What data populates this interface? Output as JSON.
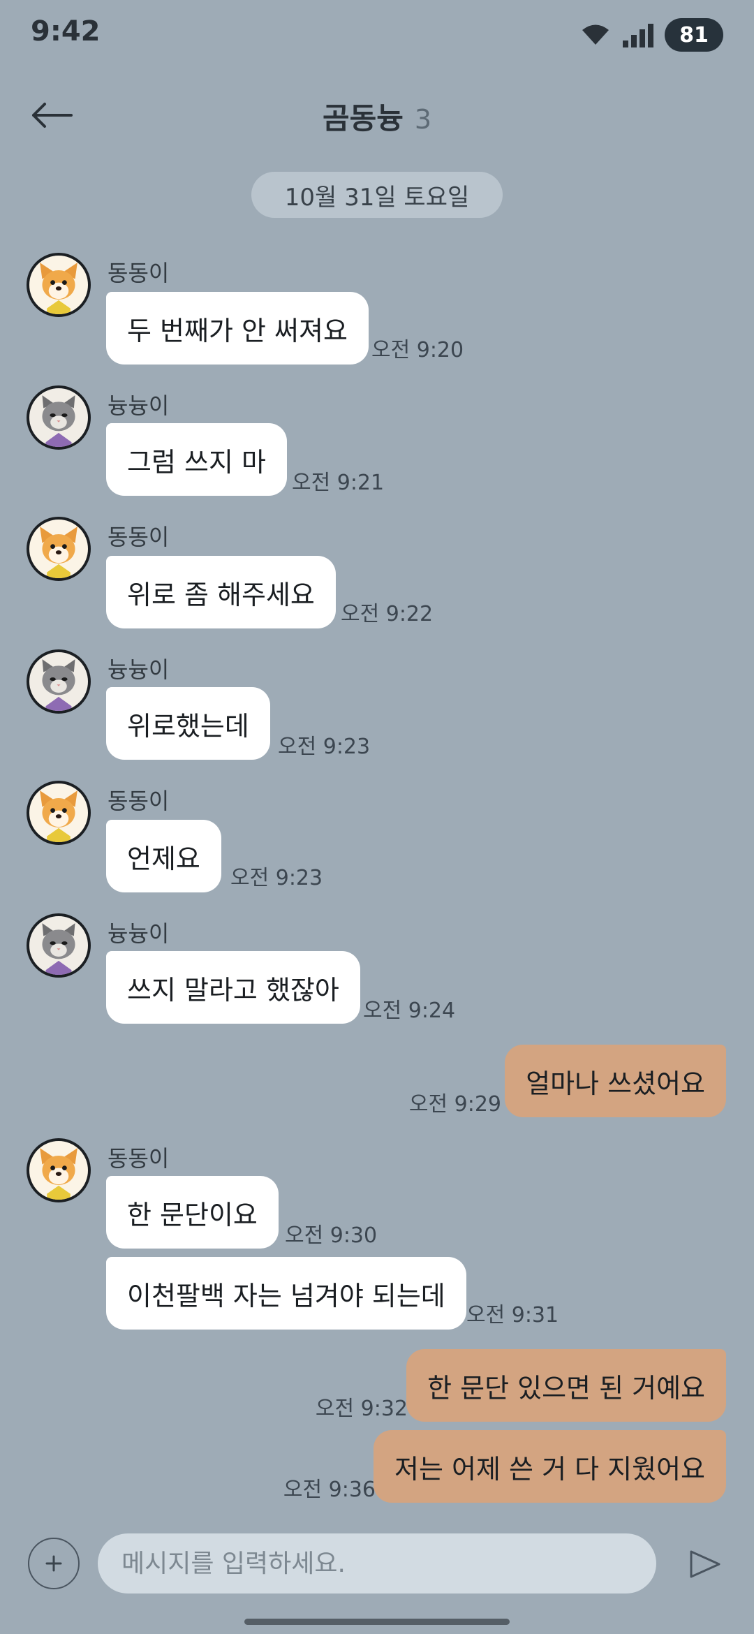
{
  "status_bar": {
    "time": "9:42",
    "battery": "81"
  },
  "header": {
    "title": "곰동늉",
    "member_count": "3"
  },
  "date_divider": "10월 31일 토요일",
  "messages": [
    {
      "sender": "동동이",
      "avatar": "dog-avatar",
      "text": "두 번째가 안 써져요",
      "time": "오전 9:20"
    },
    {
      "sender": "늉늉이",
      "avatar": "cat-avatar",
      "text": "그럼 쓰지 마",
      "time": "오전 9:21"
    },
    {
      "sender": "동동이",
      "avatar": "dog-avatar",
      "text": "위로 좀 해주세요",
      "time": "오전 9:22"
    },
    {
      "sender": "늉늉이",
      "avatar": "cat-avatar",
      "text": "위로했는데",
      "time": "오전 9:23"
    },
    {
      "sender": "동동이",
      "avatar": "dog-avatar",
      "text": "언제요",
      "time": "오전 9:23"
    },
    {
      "sender": "늉늉이",
      "avatar": "cat-avatar",
      "text": "쓰지 말라고 했잖아",
      "time": "오전 9:24"
    },
    {
      "sender": "me",
      "text": "얼마나 쓰셨어요",
      "time": "오전 9:29"
    },
    {
      "sender": "동동이",
      "avatar": "dog-avatar",
      "text": "한 문단이요",
      "time": "오전 9:30"
    },
    {
      "sender": "동동이",
      "text": "이천팔백 자는 넘겨야 되는데",
      "time": "오전 9:31"
    },
    {
      "sender": "me",
      "text": "한 문단 있으면 된 거예요",
      "time": "오전 9:32"
    },
    {
      "sender": "me",
      "text": "저는 어제 쓴 거 다 지웠어요",
      "time": "오전 9:36"
    }
  ],
  "composer": {
    "placeholder": "메시지를 입력하세요."
  },
  "icons": {
    "back": "back-arrow-icon",
    "add": "plus-icon",
    "send": "send-icon",
    "wifi": "wifi-icon",
    "signal": "signal-icon"
  },
  "colors": {
    "background": "#9eabb6",
    "incoming_bubble": "#ffffff",
    "outgoing_bubble": "#d3a481",
    "date_chip": "#b9c4cd"
  }
}
